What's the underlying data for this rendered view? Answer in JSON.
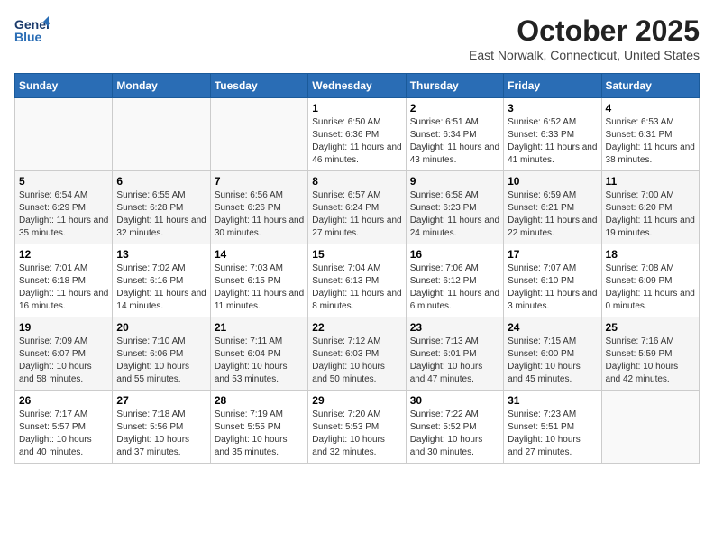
{
  "header": {
    "logo_line1": "General",
    "logo_line2": "Blue",
    "month": "October 2025",
    "location": "East Norwalk, Connecticut, United States"
  },
  "days_of_week": [
    "Sunday",
    "Monday",
    "Tuesday",
    "Wednesday",
    "Thursday",
    "Friday",
    "Saturday"
  ],
  "weeks": [
    [
      {
        "num": "",
        "info": ""
      },
      {
        "num": "",
        "info": ""
      },
      {
        "num": "",
        "info": ""
      },
      {
        "num": "1",
        "info": "Sunrise: 6:50 AM\nSunset: 6:36 PM\nDaylight: 11 hours and 46 minutes."
      },
      {
        "num": "2",
        "info": "Sunrise: 6:51 AM\nSunset: 6:34 PM\nDaylight: 11 hours and 43 minutes."
      },
      {
        "num": "3",
        "info": "Sunrise: 6:52 AM\nSunset: 6:33 PM\nDaylight: 11 hours and 41 minutes."
      },
      {
        "num": "4",
        "info": "Sunrise: 6:53 AM\nSunset: 6:31 PM\nDaylight: 11 hours and 38 minutes."
      }
    ],
    [
      {
        "num": "5",
        "info": "Sunrise: 6:54 AM\nSunset: 6:29 PM\nDaylight: 11 hours and 35 minutes."
      },
      {
        "num": "6",
        "info": "Sunrise: 6:55 AM\nSunset: 6:28 PM\nDaylight: 11 hours and 32 minutes."
      },
      {
        "num": "7",
        "info": "Sunrise: 6:56 AM\nSunset: 6:26 PM\nDaylight: 11 hours and 30 minutes."
      },
      {
        "num": "8",
        "info": "Sunrise: 6:57 AM\nSunset: 6:24 PM\nDaylight: 11 hours and 27 minutes."
      },
      {
        "num": "9",
        "info": "Sunrise: 6:58 AM\nSunset: 6:23 PM\nDaylight: 11 hours and 24 minutes."
      },
      {
        "num": "10",
        "info": "Sunrise: 6:59 AM\nSunset: 6:21 PM\nDaylight: 11 hours and 22 minutes."
      },
      {
        "num": "11",
        "info": "Sunrise: 7:00 AM\nSunset: 6:20 PM\nDaylight: 11 hours and 19 minutes."
      }
    ],
    [
      {
        "num": "12",
        "info": "Sunrise: 7:01 AM\nSunset: 6:18 PM\nDaylight: 11 hours and 16 minutes."
      },
      {
        "num": "13",
        "info": "Sunrise: 7:02 AM\nSunset: 6:16 PM\nDaylight: 11 hours and 14 minutes."
      },
      {
        "num": "14",
        "info": "Sunrise: 7:03 AM\nSunset: 6:15 PM\nDaylight: 11 hours and 11 minutes."
      },
      {
        "num": "15",
        "info": "Sunrise: 7:04 AM\nSunset: 6:13 PM\nDaylight: 11 hours and 8 minutes."
      },
      {
        "num": "16",
        "info": "Sunrise: 7:06 AM\nSunset: 6:12 PM\nDaylight: 11 hours and 6 minutes."
      },
      {
        "num": "17",
        "info": "Sunrise: 7:07 AM\nSunset: 6:10 PM\nDaylight: 11 hours and 3 minutes."
      },
      {
        "num": "18",
        "info": "Sunrise: 7:08 AM\nSunset: 6:09 PM\nDaylight: 11 hours and 0 minutes."
      }
    ],
    [
      {
        "num": "19",
        "info": "Sunrise: 7:09 AM\nSunset: 6:07 PM\nDaylight: 10 hours and 58 minutes."
      },
      {
        "num": "20",
        "info": "Sunrise: 7:10 AM\nSunset: 6:06 PM\nDaylight: 10 hours and 55 minutes."
      },
      {
        "num": "21",
        "info": "Sunrise: 7:11 AM\nSunset: 6:04 PM\nDaylight: 10 hours and 53 minutes."
      },
      {
        "num": "22",
        "info": "Sunrise: 7:12 AM\nSunset: 6:03 PM\nDaylight: 10 hours and 50 minutes."
      },
      {
        "num": "23",
        "info": "Sunrise: 7:13 AM\nSunset: 6:01 PM\nDaylight: 10 hours and 47 minutes."
      },
      {
        "num": "24",
        "info": "Sunrise: 7:15 AM\nSunset: 6:00 PM\nDaylight: 10 hours and 45 minutes."
      },
      {
        "num": "25",
        "info": "Sunrise: 7:16 AM\nSunset: 5:59 PM\nDaylight: 10 hours and 42 minutes."
      }
    ],
    [
      {
        "num": "26",
        "info": "Sunrise: 7:17 AM\nSunset: 5:57 PM\nDaylight: 10 hours and 40 minutes."
      },
      {
        "num": "27",
        "info": "Sunrise: 7:18 AM\nSunset: 5:56 PM\nDaylight: 10 hours and 37 minutes."
      },
      {
        "num": "28",
        "info": "Sunrise: 7:19 AM\nSunset: 5:55 PM\nDaylight: 10 hours and 35 minutes."
      },
      {
        "num": "29",
        "info": "Sunrise: 7:20 AM\nSunset: 5:53 PM\nDaylight: 10 hours and 32 minutes."
      },
      {
        "num": "30",
        "info": "Sunrise: 7:22 AM\nSunset: 5:52 PM\nDaylight: 10 hours and 30 minutes."
      },
      {
        "num": "31",
        "info": "Sunrise: 7:23 AM\nSunset: 5:51 PM\nDaylight: 10 hours and 27 minutes."
      },
      {
        "num": "",
        "info": ""
      }
    ]
  ]
}
